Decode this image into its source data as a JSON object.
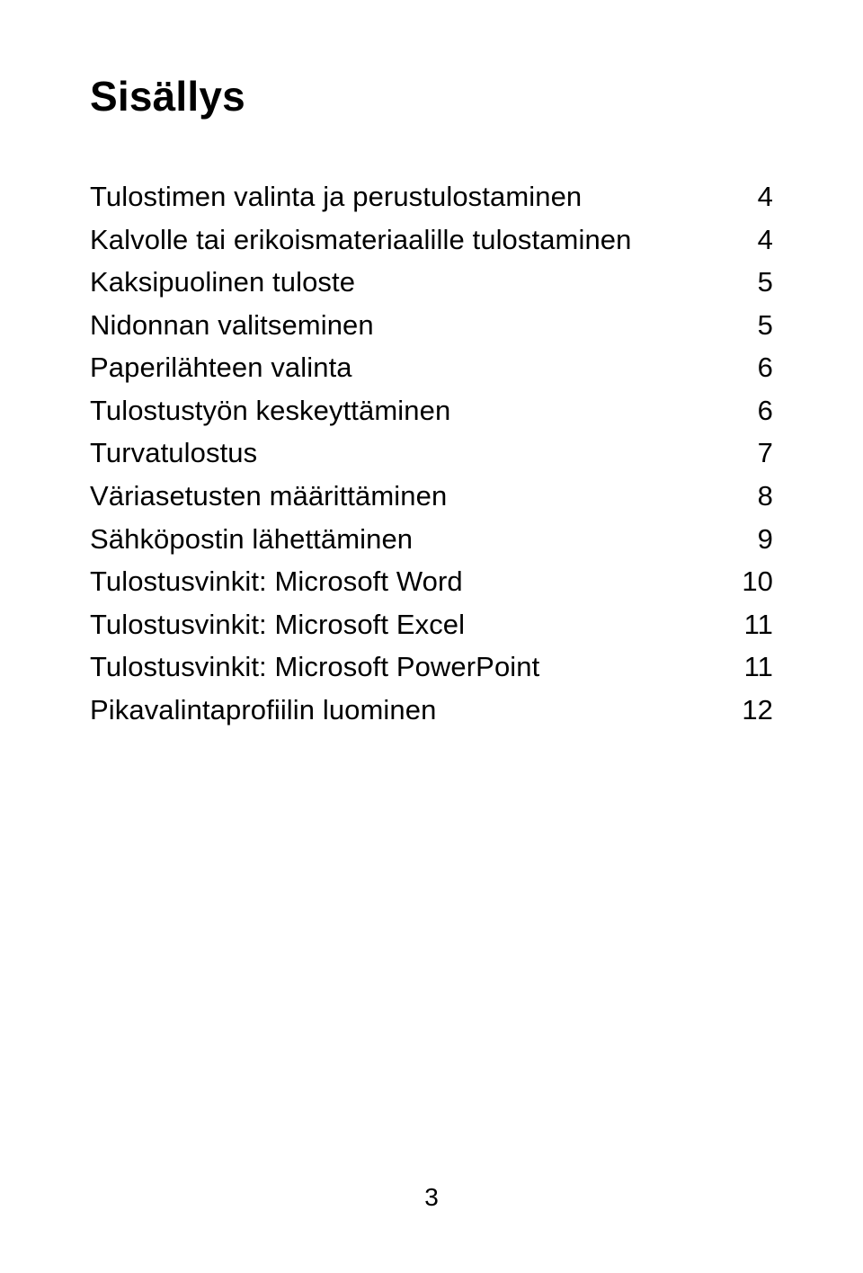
{
  "title": "Sisällys",
  "toc": [
    {
      "label": "Tulostimen valinta ja perustulostaminen",
      "page": "4"
    },
    {
      "label": "Kalvolle tai erikoismateriaalille tulostaminen",
      "page": "4"
    },
    {
      "label": "Kaksipuolinen tuloste",
      "page": "5"
    },
    {
      "label": "Nidonnan valitseminen",
      "page": "5"
    },
    {
      "label": "Paperilähteen valinta",
      "page": "6"
    },
    {
      "label": "Tulostustyön keskeyttäminen",
      "page": "6"
    },
    {
      "label": "Turvatulostus",
      "page": "7"
    },
    {
      "label": "Väriasetusten määrittäminen",
      "page": "8"
    },
    {
      "label": "Sähköpostin lähettäminen",
      "page": "9"
    },
    {
      "label": "Tulostusvinkit: Microsoft Word",
      "page": "10"
    },
    {
      "label": "Tulostusvinkit: Microsoft Excel",
      "page": "11"
    },
    {
      "label": "Tulostusvinkit: Microsoft PowerPoint",
      "page": "11"
    },
    {
      "label": "Pikavalintaprofiilin luominen",
      "page": "12"
    }
  ],
  "page_number": "3"
}
